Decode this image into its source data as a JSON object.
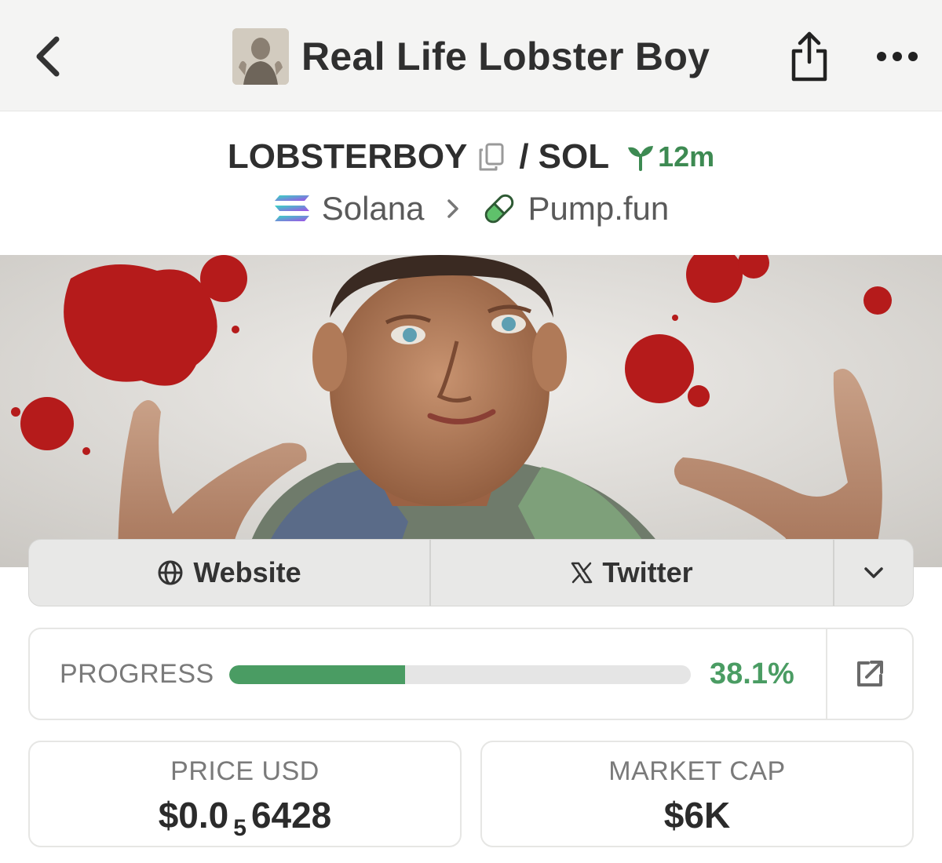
{
  "header": {
    "title": "Real Life Lobster Boy",
    "back_icon": "chevron-left-icon",
    "share_icon": "share-icon",
    "more_icon": "ellipsis-icon"
  },
  "pair": {
    "base": "LOBSTERBOY",
    "separator": "/",
    "quote": "SOL",
    "age": "12m",
    "age_icon": "seedling-icon"
  },
  "chain": {
    "name": "Solana",
    "dex": "Pump.fun"
  },
  "links": {
    "website": "Website",
    "twitter": "Twitter"
  },
  "progress": {
    "label": "PROGRESS",
    "value_text": "38.1%",
    "fraction": 0.381
  },
  "stats": {
    "price": {
      "label": "PRICE USD",
      "prefix": "$0.0",
      "zeros": "5",
      "digits": "6428"
    },
    "market_cap": {
      "label": "MARKET CAP",
      "value": "$6K"
    }
  },
  "colors": {
    "accent_green": "#4a9c63",
    "age_green": "#3d8a52",
    "nav_bg": "#f4f4f3"
  }
}
